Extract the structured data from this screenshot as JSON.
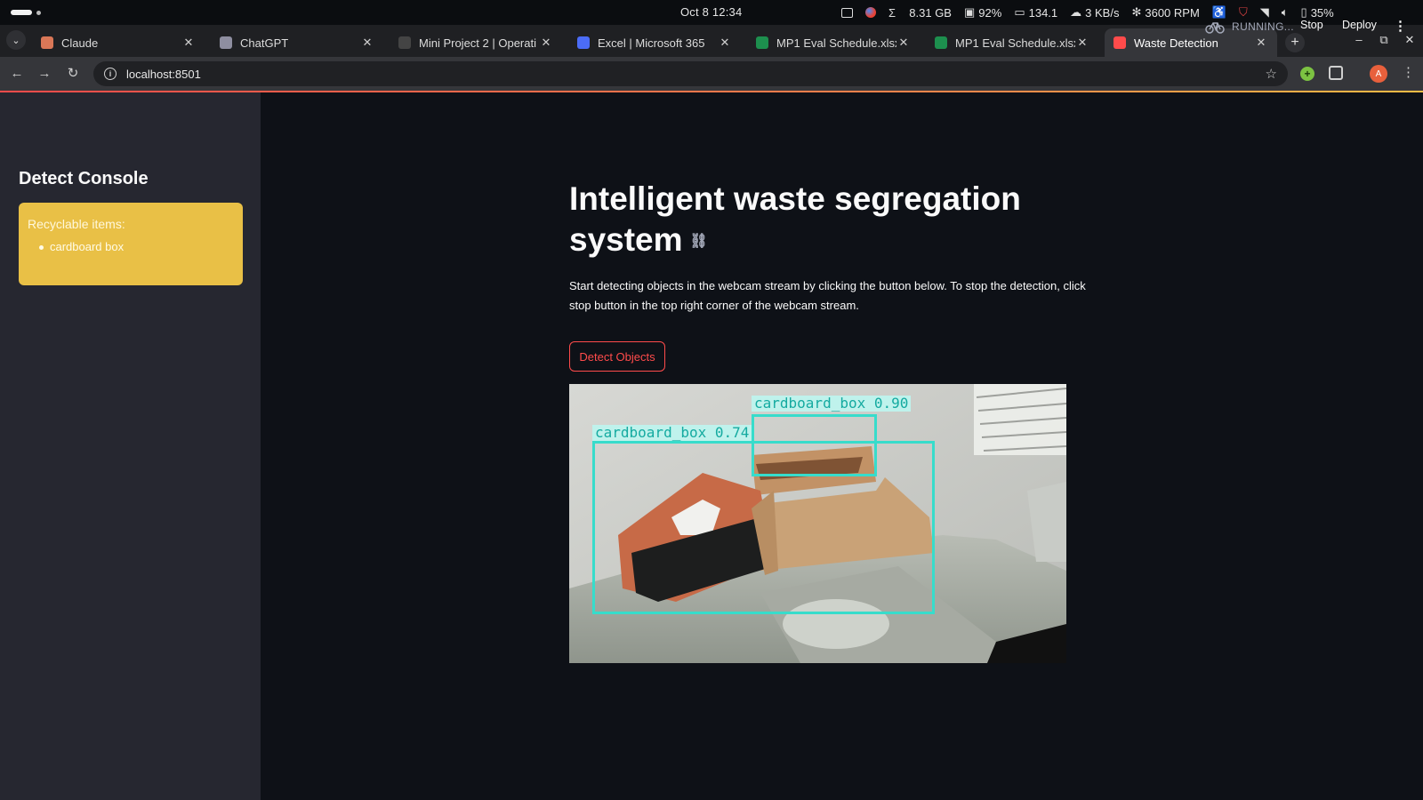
{
  "os_bar": {
    "clock": "Oct 8  12:34",
    "memory": "8.31 GB",
    "cpu": "92%",
    "display": "134.1",
    "network": "3 KB/s",
    "fan": "3600 RPM",
    "battery": "35%"
  },
  "browser": {
    "tabs": [
      {
        "title": "Claude",
        "icon": "claude-icon",
        "color": "#d97757"
      },
      {
        "title": "ChatGPT",
        "icon": "chatgpt-icon",
        "color": "#8e8ea0"
      },
      {
        "title": "Mini Project 2 | Operati",
        "icon": "project-icon",
        "color": "#444"
      },
      {
        "title": "Excel | Microsoft 365",
        "icon": "office-icon",
        "color": "#4b6cf7"
      },
      {
        "title": "MP1 Eval Schedule.xlsx",
        "icon": "excel-icon",
        "color": "#1d8f4e"
      },
      {
        "title": "MP1 Eval Schedule.xlsx",
        "icon": "excel-icon",
        "color": "#1d8f4e"
      },
      {
        "title": "Waste Detection",
        "icon": "streamlit-icon",
        "color": "#ff4b4b"
      }
    ],
    "url": "localhost:8501",
    "avatar_letter": "A"
  },
  "app": {
    "status": "RUNNING...",
    "stop_label": "Stop",
    "deploy_label": "Deploy",
    "accent_color": "#ff4b4b",
    "sidebar": {
      "title": "Detect Console",
      "alert_heading": "Recyclable items:",
      "items": [
        "cardboard box"
      ]
    },
    "main": {
      "title": "Intelligent waste segregation system",
      "description": "Start detecting objects in the webcam stream by clicking the button below. To stop the detection, click stop button in the top right corner of the webcam stream.",
      "detect_button": "Detect Objects"
    },
    "detections": [
      {
        "label": "cardboard_box 0.90",
        "score": 0.9
      },
      {
        "label": "cardboard_box 0.74",
        "score": 0.74
      }
    ]
  }
}
